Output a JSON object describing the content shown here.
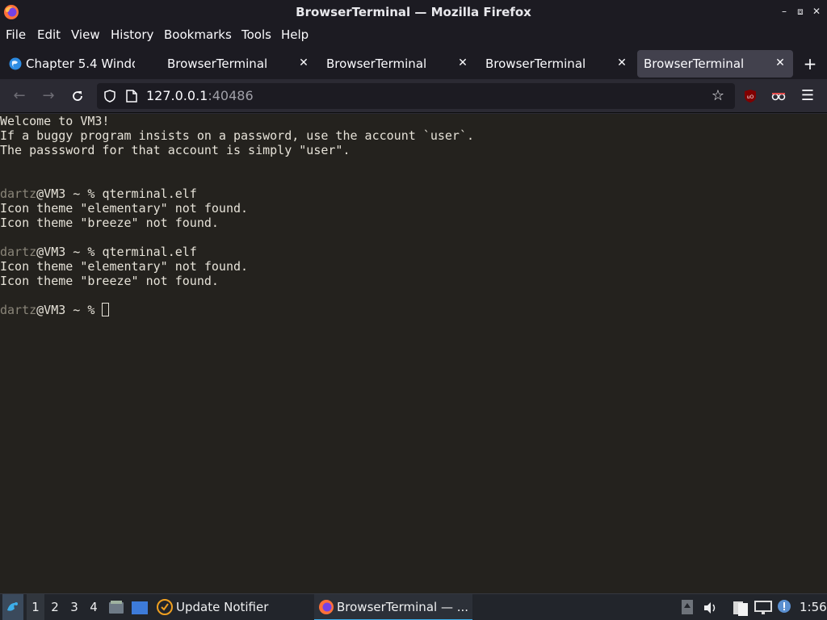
{
  "window": {
    "title": "BrowserTerminal — Mozilla Firefox"
  },
  "menubar": {
    "items": [
      {
        "label": "File"
      },
      {
        "label": "Edit"
      },
      {
        "label": "View"
      },
      {
        "label": "History"
      },
      {
        "label": "Bookmarks"
      },
      {
        "label": "Tools"
      },
      {
        "label": "Help"
      }
    ]
  },
  "tabs": [
    {
      "label": "Chapter 5.4 Windo",
      "icon": "globe-icon",
      "active": false
    },
    {
      "label": "BrowserTerminal",
      "active": false
    },
    {
      "label": "BrowserTerminal",
      "active": false
    },
    {
      "label": "BrowserTerminal",
      "active": false
    },
    {
      "label": "BrowserTerminal",
      "active": true
    }
  ],
  "navbar": {
    "url_host": "127.0.0.1",
    "url_port": ":40486"
  },
  "terminal": {
    "lines": [
      "Welcome to VM3!",
      "If a buggy program insists on a password, use the account `user`.",
      "The passsword for that account is simply \"user\".",
      "",
      "",
      "Icon theme \"elementary\" not found.",
      "Icon theme \"breeze\" not found.",
      "",
      "",
      "Icon theme \"elementary\" not found.",
      "Icon theme \"breeze\" not found.",
      ""
    ],
    "prompt_user": "dartz",
    "prompt_host": "@VM3 ~ % ",
    "commands": [
      "qterminal.elf",
      "qterminal.elf",
      ""
    ]
  },
  "taskbar": {
    "workspaces": [
      "1",
      "2",
      "3",
      "4"
    ],
    "update_notifier": "Update Notifier",
    "active_window": "BrowserTerminal — ...",
    "clock": "1:56"
  },
  "colors": {
    "terminal_bg": "#24221e",
    "terminal_fg": "#e6e2d8",
    "accent": "#3daee9"
  }
}
